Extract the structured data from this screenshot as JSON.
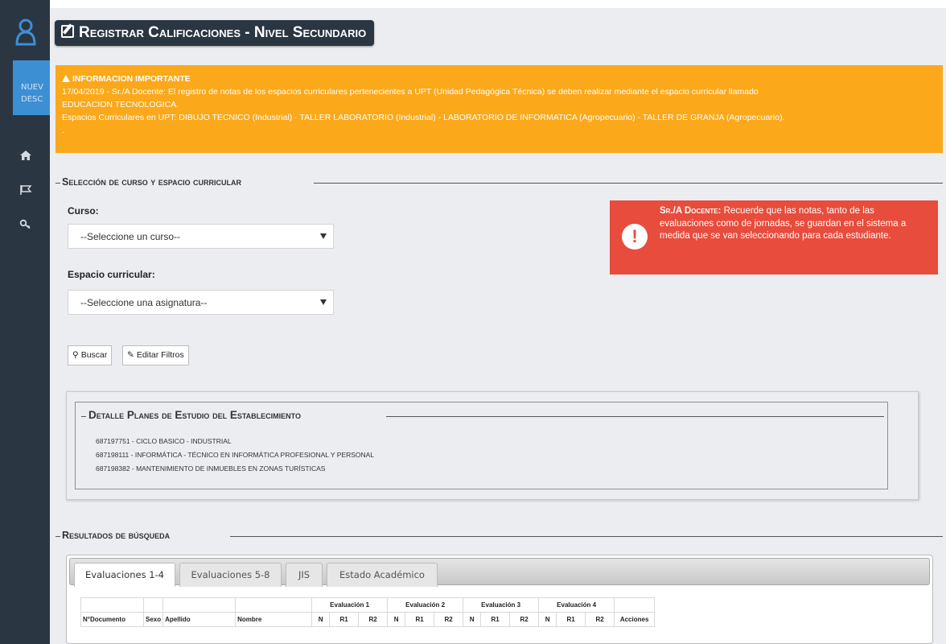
{
  "header": {
    "title": "Registrar Calificaciones - Nivel Secundario"
  },
  "sidebar": {
    "new_label_1": "NUEV",
    "new_label_2": "DESC",
    "icons": [
      "home-icon",
      "flag-icon",
      "key-icon"
    ]
  },
  "warning": {
    "title": "INFORMACION IMPORTANTE",
    "line1": "17/04/2019 - Sr./A Docente: El registro de notas de los espacios curriculares pertenecientes a UPT (Unidad Pedagógica Técnica) se deben realizar mediante el espacio curricular llamado",
    "line2": "EDUCACION TECNOLOGICA.",
    "line3": "Espacios Curriculares en UPT: DIBUJO TECNICO (Industrial) - TALLER LABORATORIO (Industrial) - LABORATORIO DE INFORMATICA (Agropecuario) - TALLER DE GRANJA (Agropecuario).",
    "line4": ".",
    "color": "#fba81a"
  },
  "selection": {
    "legend": "Selección de curso y espacio curricular",
    "curso_label": "Curso:",
    "curso_value": "--Seleccione un curso--",
    "espacio_label": "Espacio curricular:",
    "espacio_value": "--Seleccione una asignatura--",
    "buscar_label": "Buscar",
    "editar_label": "Editar Filtros"
  },
  "alert": {
    "prefix": "Sr./A Docente:",
    "text": "Recuerde que las notas, tanto de las evaluaciones como de jornadas, se guardan en el sistema a medida que se van seleccionando para cada estudiante.",
    "color": "#e74c3c"
  },
  "planes": {
    "legend": "Detalle Planes de Estudio del Establecimiento",
    "items": [
      "687197751 - CICLO BASICO - INDUSTRIAL",
      "687198111 - INFORMÁTICA - TÉCNICO EN INFORMÁTICA PROFESIONAL Y PERSONAL",
      "687198382 - MANTENIMIENTO DE INMUEBLES EN ZONAS TURÍSTICAS"
    ]
  },
  "results": {
    "legend": "Resultados de búsqueda",
    "tabs": [
      "Evaluaciones 1-4",
      "Evaluaciones 5-8",
      "JIS",
      "Estado Académico"
    ],
    "group_headers": [
      "Evaluación 1",
      "Evaluación 2",
      "Evaluación 3",
      "Evaluación 4"
    ],
    "columns": {
      "doc": "N°Documento",
      "sexo": "Sexo",
      "apellido": "Apellido",
      "nombre": "Nombre",
      "n": "N",
      "r1": "R1",
      "r2": "R2",
      "acciones": "Acciones"
    }
  }
}
